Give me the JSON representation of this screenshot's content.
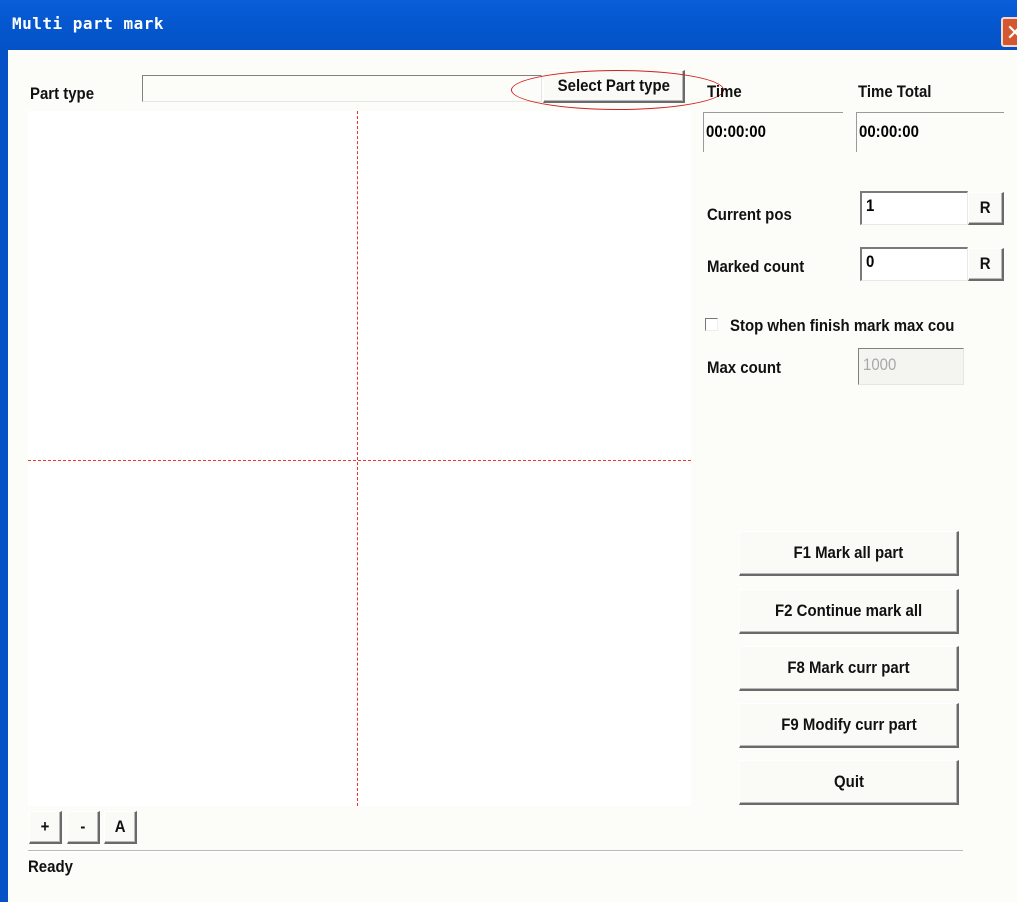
{
  "window": {
    "title": "Multi part mark",
    "close_glyph": "✕"
  },
  "part_type": {
    "label": "Part type",
    "value": "",
    "select_button": "Select Part type"
  },
  "time": {
    "label": "Time",
    "value": "00:00:00",
    "total_label": "Time Total",
    "total_value": "00:00:00"
  },
  "current_pos": {
    "label": "Current pos",
    "value": "1",
    "reset": "R"
  },
  "marked_count": {
    "label": "Marked count",
    "value": "0",
    "reset": "R"
  },
  "stop_option": {
    "label": "Stop when finish mark max cou",
    "checked": false
  },
  "max_count": {
    "label": "Max count",
    "value": "1000"
  },
  "actions": {
    "mark_all": "F1 Mark all part",
    "continue_mark_all": "F2 Continue mark all",
    "mark_curr": "F8 Mark curr part",
    "modify_curr": "F9 Modify curr part",
    "quit": "Quit"
  },
  "zoom": {
    "in": "+",
    "out": "-",
    "auto": "A"
  },
  "status": {
    "text": "Ready"
  },
  "colors": {
    "titlebar": "#0452c6",
    "crosshair": "#e33333",
    "highlight_ellipse": "#d12020"
  }
}
